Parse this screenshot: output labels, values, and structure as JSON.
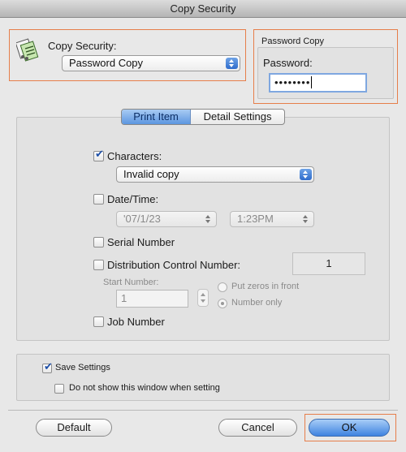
{
  "window": {
    "title": "Copy Security"
  },
  "copy_security": {
    "label": "Copy Security:",
    "selected": "Password Copy",
    "icon": "copy-security-icon"
  },
  "password_copy": {
    "group_title": "Password Copy",
    "label": "Password:",
    "value": "••••••••"
  },
  "tabs": [
    {
      "label": "Print Item",
      "active": true
    },
    {
      "label": "Detail Settings",
      "active": false
    }
  ],
  "items": {
    "characters": {
      "label": "Characters:",
      "checked": true,
      "selected": "Invalid copy"
    },
    "date_time": {
      "label": "Date/Time:",
      "checked": false,
      "date": "'07/1/23",
      "time": "1:23PM"
    },
    "serial_number": {
      "label": "Serial Number",
      "checked": false
    },
    "distribution_control": {
      "label": "Distribution Control Number:",
      "checked": false,
      "value": "1",
      "start_number_label": "Start Number:",
      "start_number": "1",
      "option_zeros": "Put zeros in front",
      "option_number_only": "Number only",
      "selected_option": "Number only"
    },
    "job_number": {
      "label": "Job Number",
      "checked": false
    }
  },
  "settings": {
    "save_settings": {
      "label": "Save Settings",
      "checked": true
    },
    "do_not_show": {
      "label": "Do not show this window when setting",
      "checked": false
    }
  },
  "buttons": {
    "default": "Default",
    "cancel": "Cancel",
    "ok": "OK"
  },
  "colors": {
    "highlight": "#e67e4a",
    "accent": "#3f83e0"
  }
}
